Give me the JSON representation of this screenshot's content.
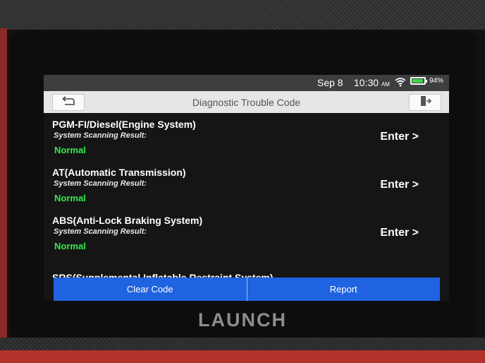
{
  "status_bar": {
    "date": "Sep 8",
    "time": "10:30",
    "ampm": "AM",
    "battery_percent": "94%",
    "battery_level": 0.94,
    "wifi_icon": "wifi-icon"
  },
  "header": {
    "title": "Diagnostic Trouble Code",
    "back_icon": "back-arrow-icon",
    "exit_icon": "exit-door-icon"
  },
  "systems": [
    {
      "name": "PGM-FI/Diesel(Engine System)",
      "subtitle": "System Scanning Result:",
      "status": "Normal",
      "action": "Enter >"
    },
    {
      "name": "AT(Automatic Transmission)",
      "subtitle": "System Scanning Result:",
      "status": "Normal",
      "action": "Enter >"
    },
    {
      "name": "ABS(Anti-Lock Braking System)",
      "subtitle": "System Scanning Result:",
      "status": "Normal",
      "action": "Enter >"
    },
    {
      "name": "SRS(Supplemental Inflatable Restraint System)"
    }
  ],
  "footer": {
    "clear_label": "Clear Code",
    "report_label": "Report"
  },
  "device": {
    "brand": "LAUNCH"
  },
  "colors": {
    "status_normal": "#35e84a",
    "footer_bar": "#1f63e0",
    "titlebar": "#e6e6e6"
  }
}
